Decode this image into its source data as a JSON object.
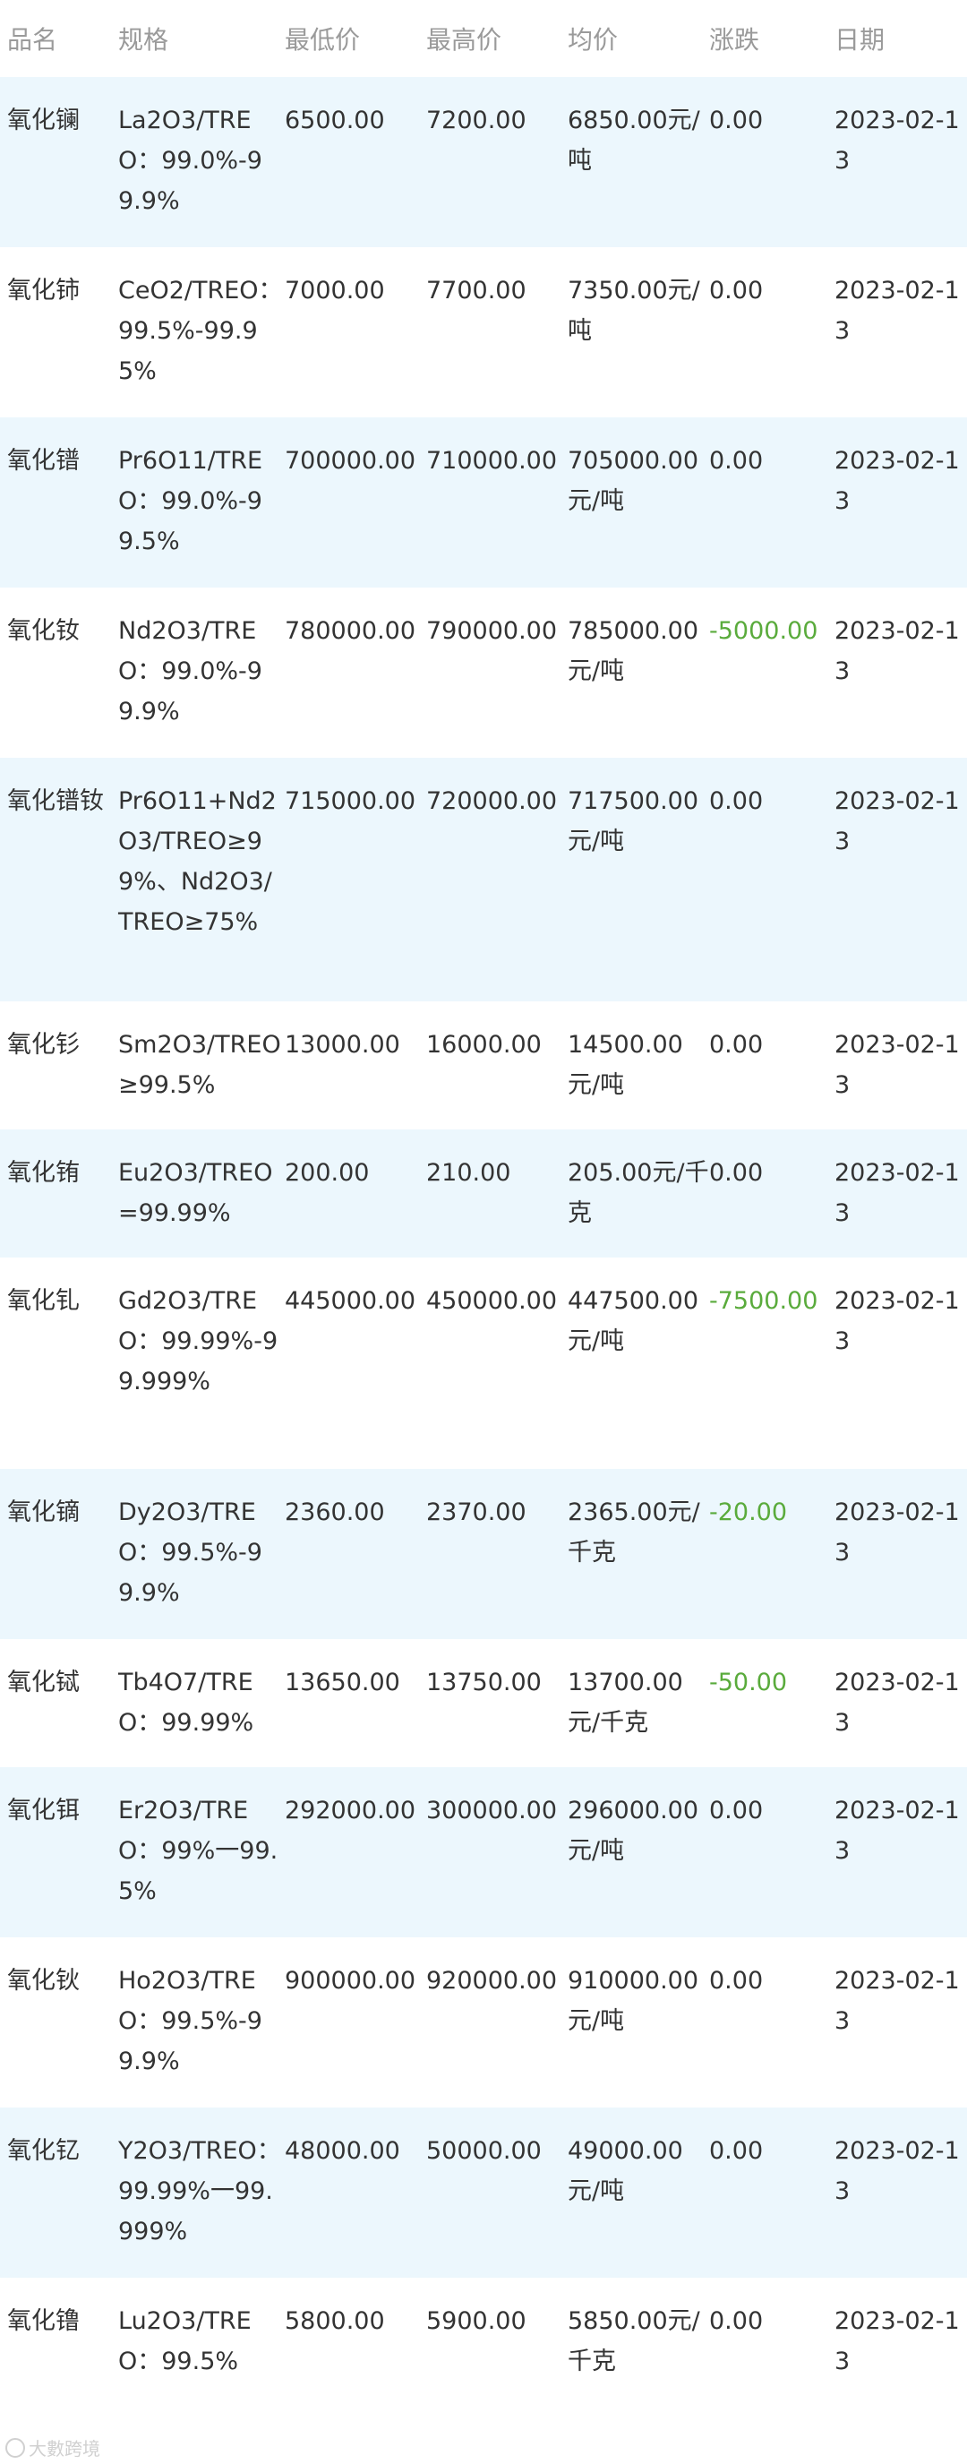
{
  "table": {
    "headers": [
      "品名",
      "规格",
      "最低价",
      "最高价",
      "均价",
      "涨跌",
      "日期"
    ],
    "rows": [
      {
        "name": "氧化镧",
        "spec": "La2O3/TREO：99.0%-99.9%",
        "low": "6500.00",
        "high": "7200.00",
        "avg": "6850.00元/吨",
        "change": "0.00",
        "date": "2023-02-13",
        "down": false
      },
      {
        "name": "氧化铈",
        "spec": "CeO2/TREO：99.5%-99.95%",
        "low": "7000.00",
        "high": "7700.00",
        "avg": "7350.00元/吨",
        "change": "0.00",
        "date": "2023-02-13",
        "down": false
      },
      {
        "name": "氧化镨",
        "spec": "Pr6O11/TREO：99.0%-99.5%",
        "low": "700000.00",
        "high": "710000.00",
        "avg": "705000.00元/吨",
        "change": "0.00",
        "date": "2023-02-13",
        "down": false
      },
      {
        "name": "氧化钕",
        "spec": "Nd2O3/TREO：99.0%-99.9%",
        "low": "780000.00",
        "high": "790000.00",
        "avg": "785000.00元/吨",
        "change": "-5000.00",
        "date": "2023-02-13",
        "down": true
      },
      {
        "name": "氧化镨钕",
        "spec": "Pr6O11+Nd2O3/TREO≥99%、Nd2O3/TREO≥75%",
        "low": "715000.00",
        "high": "720000.00",
        "avg": "717500.00元/吨",
        "change": "0.00",
        "date": "2023-02-13",
        "down": false
      },
      {
        "name": "氧化钐",
        "spec": "Sm2O3/TREO≥99.5%",
        "low": "13000.00",
        "high": "16000.00",
        "avg": "14500.00元/吨",
        "change": "0.00",
        "date": "2023-02-13",
        "down": false
      },
      {
        "name": "氧化铕",
        "spec": "Eu2O3/TREO=99.99%",
        "low": "200.00",
        "high": "210.00",
        "avg": "205.00元/千克",
        "change": "0.00",
        "date": "2023-02-13",
        "down": false
      },
      {
        "name": "氧化钆",
        "spec": "Gd2O3/TREO：99.99%-99.999%",
        "low": "445000.00",
        "high": "450000.00",
        "avg": "447500.00元/吨",
        "change": "-7500.00",
        "date": "2023-02-13",
        "down": true
      },
      {
        "name": "氧化镝",
        "spec": "Dy2O3/TREO：99.5%-99.9%",
        "low": "2360.00",
        "high": "2370.00",
        "avg": "2365.00元/千克",
        "change": "-20.00",
        "date": "2023-02-13",
        "down": true
      },
      {
        "name": "氧化铽",
        "spec": "Tb4O7/TREO：99.99%",
        "low": "13650.00",
        "high": "13750.00",
        "avg": "13700.00元/千克",
        "change": "-50.00",
        "date": "2023-02-13",
        "down": true
      },
      {
        "name": "氧化铒",
        "spec": "Er2O3/TREO：99%一99.5%",
        "low": "292000.00",
        "high": "300000.00",
        "avg": "296000.00元/吨",
        "change": "0.00",
        "date": "2023-02-13",
        "down": false
      },
      {
        "name": "氧化钬",
        "spec": "Ho2O3/TREO：99.5%-99.9%",
        "low": "900000.00",
        "high": "920000.00",
        "avg": "910000.00元/吨",
        "change": "0.00",
        "date": "2023-02-13",
        "down": false
      },
      {
        "name": "氧化钇",
        "spec": "Y2O3/TREO：99.99%一99.999%",
        "low": "48000.00",
        "high": "50000.00",
        "avg": "49000.00元/吨",
        "change": "0.00",
        "date": "2023-02-13",
        "down": false
      },
      {
        "name": "氧化镥",
        "spec": "Lu2O3/TREO：99.5%",
        "low": "5800.00",
        "high": "5900.00",
        "avg": "5850.00元/千克",
        "change": "0.00",
        "date": "2023-02-13",
        "down": false
      }
    ]
  },
  "watermark": {
    "text": "大數跨境"
  },
  "colors": {
    "row_stripe": "#ecf7fd",
    "header_text": "#9a9a9a",
    "negative_change": "#5aab3c"
  }
}
